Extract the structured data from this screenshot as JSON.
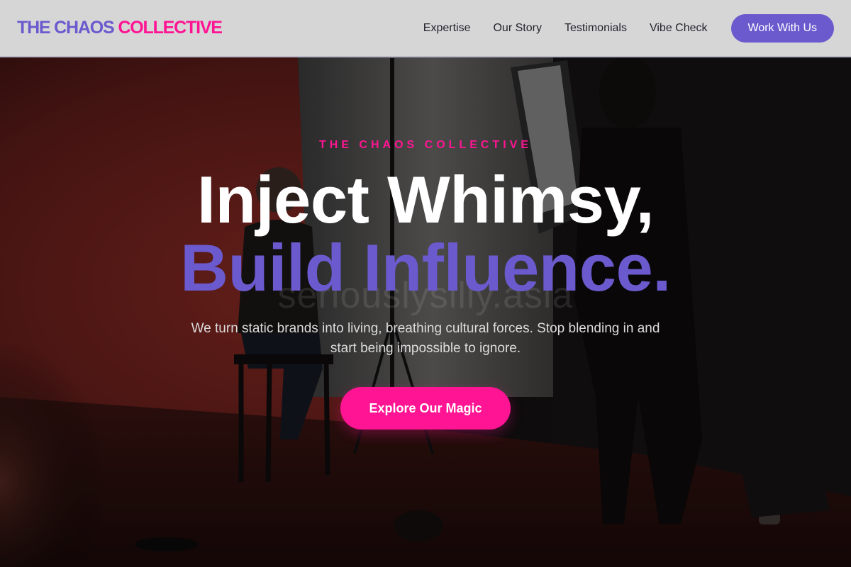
{
  "nav": {
    "logo_part1": "THE CHAOS",
    "logo_part2": "COLLECTIVE",
    "links": [
      "Expertise",
      "Our Story",
      "Testimonials",
      "Vibe Check"
    ],
    "cta": "Work With Us"
  },
  "hero": {
    "eyebrow": "THE CHAOS COLLECTIVE",
    "headline_line1": "Inject Whimsy,",
    "headline_line2": "Build Influence.",
    "subtext": "We turn static brands into living, breathing cultural forces. Stop blending in and start being impossible to ignore.",
    "cta": "Explore Our Magic",
    "watermark": "seriouslysilly.asia"
  },
  "colors": {
    "purple_accent": "#6a5acd",
    "pink_accent": "#ff1493",
    "nav_background": "#d6d6d7"
  }
}
